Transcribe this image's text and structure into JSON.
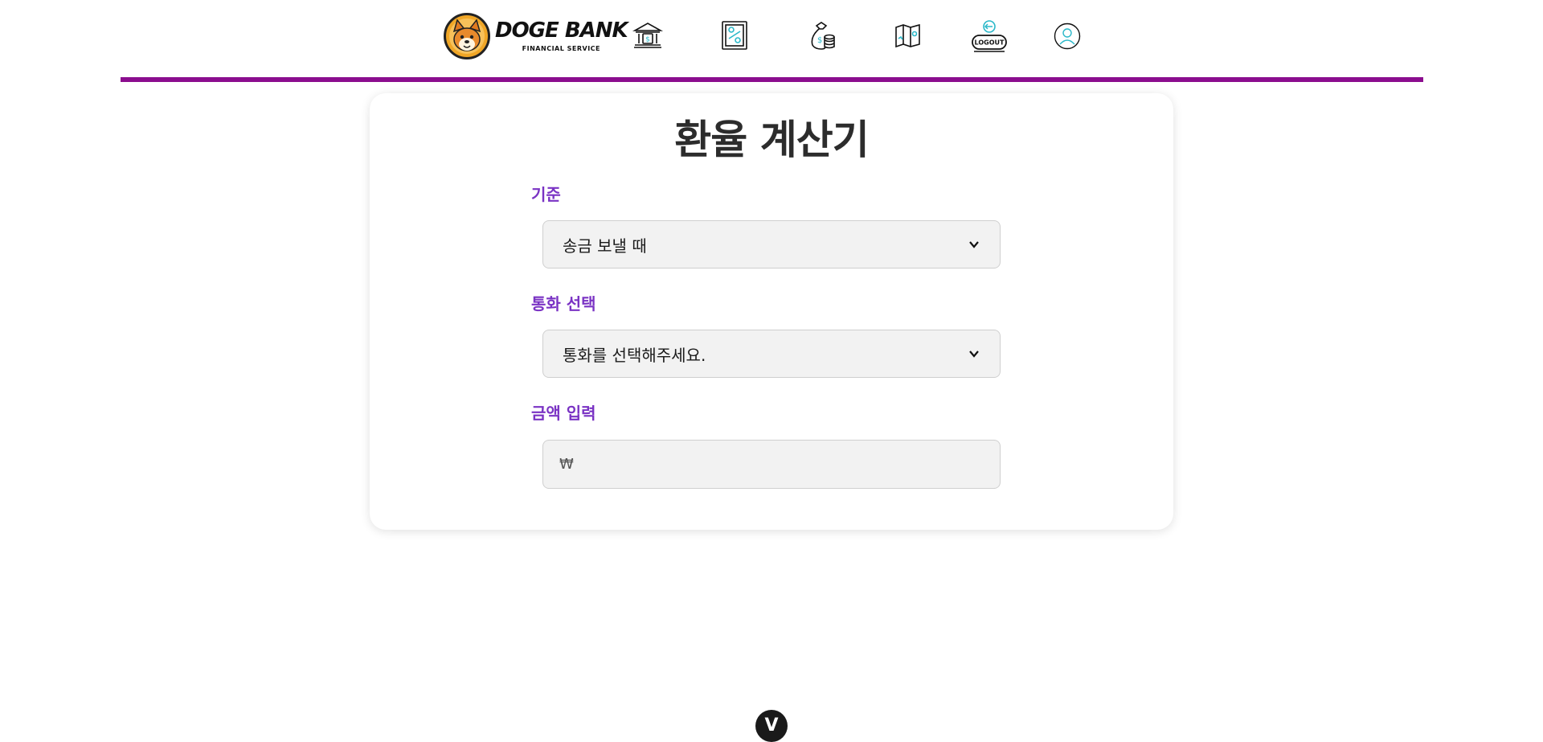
{
  "header": {
    "logo_title": "DOGE BANK",
    "logo_subtitle": "FINANCIAL SERVICE",
    "nav_icons": [
      "bank-icon",
      "exchange-board-icon",
      "money-bag-icon",
      "map-icon",
      "logout-icon",
      "profile-icon"
    ],
    "logout_label": "LOGOUT",
    "accent_color": "#8b0d8e"
  },
  "card": {
    "title": "환율 계산기",
    "fields": [
      {
        "label": "기준",
        "value": "송금 보낼 때"
      },
      {
        "label": "통화 선택",
        "value": "통화를 선택해주세요."
      },
      {
        "label": "금액 입력",
        "placeholder": "₩"
      }
    ],
    "label_color": "#7a33c4"
  },
  "scroll_button": {
    "label": "V"
  }
}
